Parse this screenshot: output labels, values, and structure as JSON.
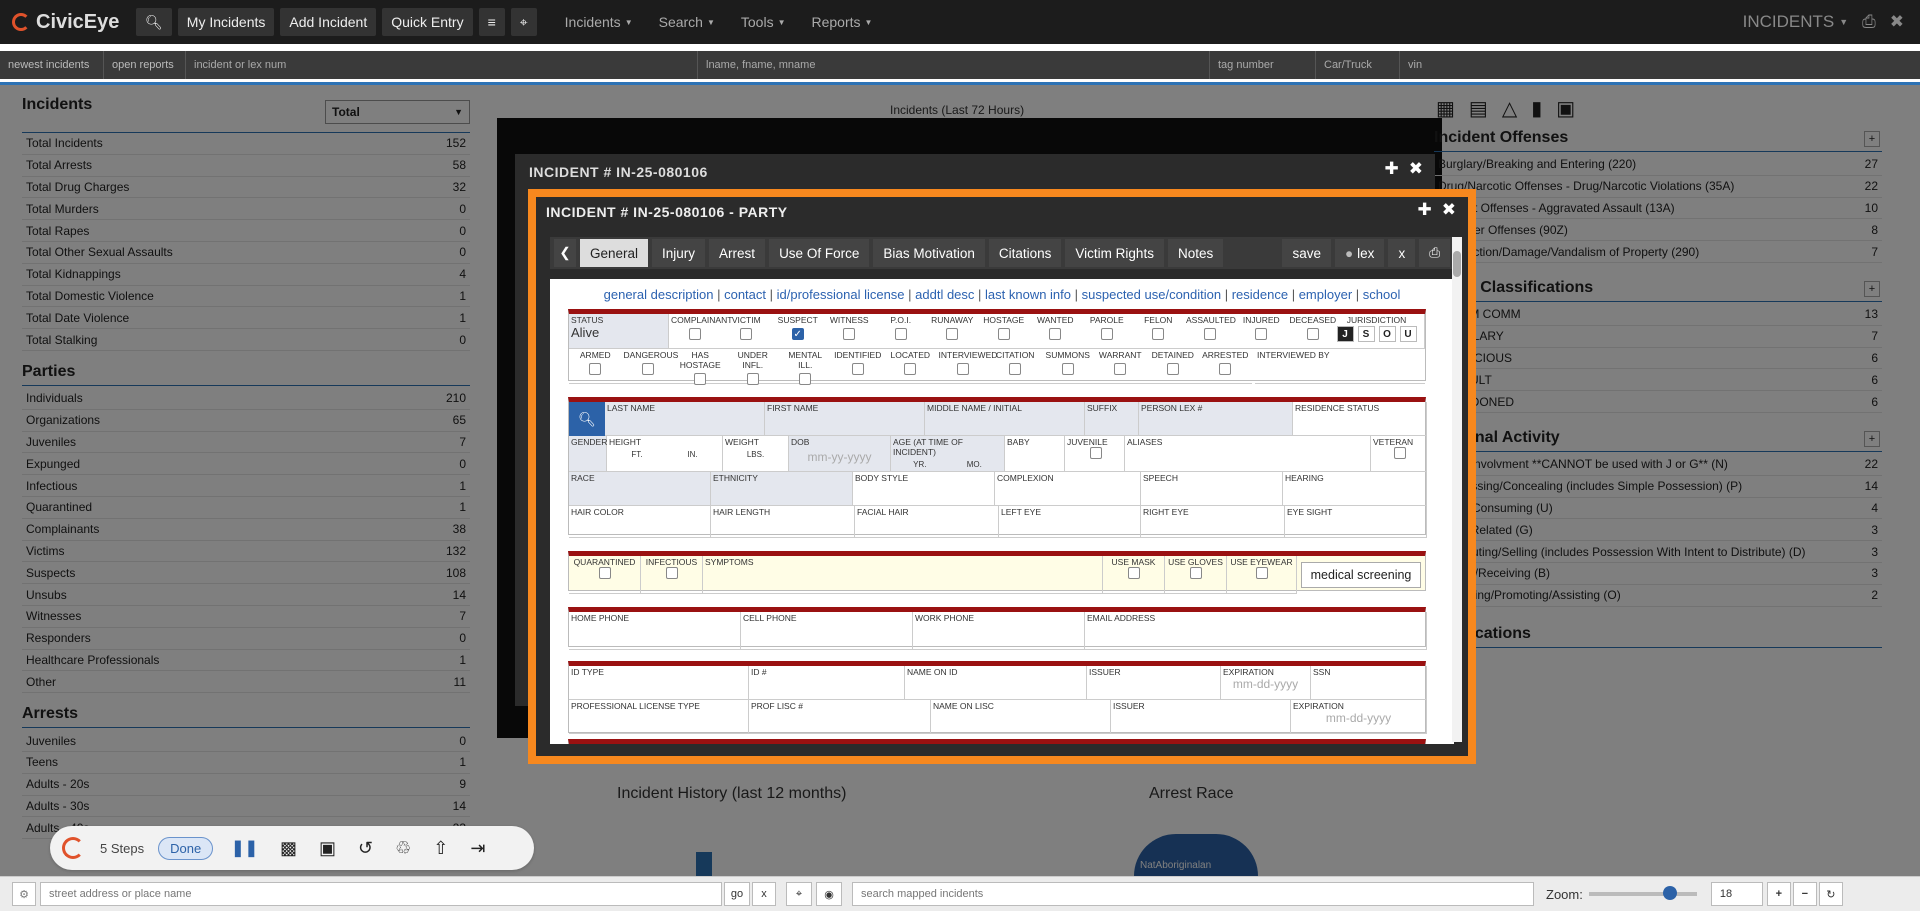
{
  "topbar": {
    "brand": "CivicEye",
    "buttons": [
      "My Incidents",
      "Add Incident",
      "Quick Entry"
    ],
    "menus": [
      "Incidents",
      "Search",
      "Tools",
      "Reports"
    ],
    "section_title": "INCIDENTS"
  },
  "searchbar": {
    "chips": [
      "newest incidents",
      "open reports"
    ],
    "incident_placeholder": "incident or lex num",
    "name_placeholder": "lname, fname, mname",
    "tag_placeholder": "tag number",
    "car_placeholder": "Car/Truck",
    "vin_placeholder": "vin"
  },
  "left": {
    "incidents_title": "Incidents",
    "filter_value": "Total",
    "incidents": [
      {
        "label": "Total Incidents",
        "value": "152"
      },
      {
        "label": "Total Arrests",
        "value": "58"
      },
      {
        "label": "Total Drug Charges",
        "value": "32"
      },
      {
        "label": "Total Murders",
        "value": "0"
      },
      {
        "label": "Total Rapes",
        "value": "0"
      },
      {
        "label": "Total Other Sexual Assaults",
        "value": "0"
      },
      {
        "label": "Total Kidnappings",
        "value": "4"
      },
      {
        "label": "Total Domestic Violence",
        "value": "1"
      },
      {
        "label": "Total Date Violence",
        "value": "1"
      },
      {
        "label": "Total Stalking",
        "value": "0"
      }
    ],
    "parties_title": "Parties",
    "parties": [
      {
        "label": "Individuals",
        "value": "210"
      },
      {
        "label": "Organizations",
        "value": "65"
      },
      {
        "label": "Juveniles",
        "value": "7"
      },
      {
        "label": "Expunged",
        "value": "0"
      },
      {
        "label": "Infectious",
        "value": "1"
      },
      {
        "label": "Quarantined",
        "value": "1"
      },
      {
        "label": "Complainants",
        "value": "38"
      },
      {
        "label": "Victims",
        "value": "132"
      },
      {
        "label": "Suspects",
        "value": "108"
      },
      {
        "label": "Unsubs",
        "value": "14"
      },
      {
        "label": "Witnesses",
        "value": "7"
      },
      {
        "label": "Responders",
        "value": "0"
      },
      {
        "label": "Healthcare Professionals",
        "value": "1"
      },
      {
        "label": "Other",
        "value": "11"
      }
    ],
    "arrests_title": "Arrests",
    "arrests": [
      {
        "label": "Juveniles",
        "value": "0"
      },
      {
        "label": "Teens",
        "value": "1"
      },
      {
        "label": "Adults - 20s",
        "value": "9"
      },
      {
        "label": "Adults - 30s",
        "value": "14"
      },
      {
        "label": "Adults - 40s",
        "value": "23"
      }
    ]
  },
  "middle": {
    "chart_title": "Incidents (Last 72 Hours)",
    "history_title": "Incident History (last 12 months)",
    "race_title": "Arrest Race",
    "race_label": "NatAboriginalan"
  },
  "right": {
    "offenses_title": "Incident Offenses",
    "offenses": [
      {
        "label": "Burglary/Breaking and Entering (220)",
        "value": "27"
      },
      {
        "label": "Drug/Narcotic Offenses - Drug/Narcotic Violations (35A)",
        "value": "22"
      },
      {
        "label": "Assault Offenses - Aggravated Assault (13A)",
        "value": "10"
      },
      {
        "label": "All Other Offenses (90Z)",
        "value": "8"
      },
      {
        "label": "Destruction/Damage/Vandalism of Property (290)",
        "value": "7"
      }
    ],
    "classifications_title": "Initial Classifications",
    "classifications": [
      {
        "label": "ALARM COMM",
        "value": "13"
      },
      {
        "label": "BURGLARY",
        "value": "7"
      },
      {
        "label": "SUSPICIOUS",
        "value": "6"
      },
      {
        "label": "ASSAULT",
        "value": "6"
      },
      {
        "label": "ABANDONED",
        "value": "6"
      }
    ],
    "activity_title": "Criminal Activity",
    "activity": [
      {
        "label": "Gang Involvment **CANNOT be used with J or G** (N)",
        "value": "22"
      },
      {
        "label": "Possessing/Concealing (includes Simple Possession) (P)",
        "value": "14"
      },
      {
        "label": "Using/Consuming (U)",
        "value": "4"
      },
      {
        "label": "Gang Related (G)",
        "value": "3"
      },
      {
        "label": "Distributing/Selling (includes Possession With Intent to Distribute) (D)",
        "value": "3"
      },
      {
        "label": "Buying/Receiving (B)",
        "value": "3"
      },
      {
        "label": "Operating/Promoting/Assisting (O)",
        "value": "2"
      }
    ],
    "notifications_title": "Notifications",
    "notifications_text": "None"
  },
  "bg_window": {
    "title": "INCIDENT # IN-25-080106"
  },
  "modal": {
    "title": "INCIDENT # IN-25-080106 - PARTY",
    "tabs": [
      "General",
      "Injury",
      "Arrest",
      "Use Of Force",
      "Bias Motivation",
      "Citations",
      "Victim Rights",
      "Notes"
    ],
    "save_label": "save",
    "user_label": "lex",
    "close_label": "x",
    "section_links": [
      "general description",
      "contact",
      "id/professional license",
      "addtl desc",
      "last known info",
      "suspected use/condition",
      "residence",
      "employer",
      "school"
    ],
    "status_label": "STATUS",
    "status_value": "Alive",
    "flags_row1": [
      "COMPLAINANT",
      "VICTIM",
      "SUSPECT",
      "WITNESS",
      "P.O.I.",
      "RUNAWAY",
      "HOSTAGE",
      "WANTED",
      "PAROLE",
      "FELON",
      "ASSAULTED",
      "INJURED",
      "DECEASED"
    ],
    "jurisdiction_label": "JURISDICTION",
    "jurisdiction_options": [
      "J",
      "S",
      "O",
      "U"
    ],
    "flags_row2": [
      "ARMED",
      "DANGEROUS",
      "HAS HOSTAGE",
      "UNDER INFL.",
      "MENTAL ILL.",
      "IDENTIFIED",
      "LOCATED",
      "INTERVIEWED",
      "CITATION",
      "SUMMONS",
      "WARRANT",
      "DETAINED",
      "ARRESTED"
    ],
    "interviewed_by": "INTERVIEWED BY",
    "name_fields": [
      "LAST NAME",
      "FIRST NAME",
      "MIDDLE NAME / INITIAL",
      "SUFFIX",
      "PERSON LEX #",
      "RESIDENCE STATUS"
    ],
    "bio_fields": {
      "gender": "GENDER",
      "height": "HEIGHT",
      "ft": "FT.",
      "in": "IN.",
      "weight": "WEIGHT",
      "lbs": "LBS.",
      "dob": "DOB",
      "dob_placeholder": "mm-yy-yyyy",
      "age": "AGE (AT TIME OF INCIDENT)",
      "yr": "YR.",
      "mo": "MO.",
      "baby": "BABY",
      "juvenile": "JUVENILE",
      "aliases": "ALIASES",
      "veteran": "VETERAN"
    },
    "desc_row1": [
      "RACE",
      "ETHNICITY",
      "BODY STYLE",
      "COMPLEXION",
      "SPEECH",
      "HEARING"
    ],
    "desc_row2": [
      "HAIR COLOR",
      "HAIR LENGTH",
      "FACIAL HAIR",
      "LEFT EYE",
      "RIGHT EYE",
      "EYE SIGHT"
    ],
    "medical": {
      "quarantined": "QUARANTINED",
      "infectious": "INFECTIOUS",
      "symptoms": "SYMPTOMS",
      "mask": "USE MASK",
      "gloves": "USE GLOVES",
      "eyewear": "USE EYEWEAR",
      "screening_button": "medical screening"
    },
    "contact_fields": [
      "HOME PHONE",
      "CELL PHONE",
      "WORK PHONE",
      "EMAIL ADDRESS"
    ],
    "id_fields": [
      "ID TYPE",
      "ID #",
      "NAME ON ID",
      "ISSUER",
      "EXPIRATION",
      "SSN"
    ],
    "id_exp_placeholder": "mm-dd-yyyy",
    "lic_fields": [
      "PROFESSIONAL LICENSE TYPE",
      "PROF LISC #",
      "NAME ON LISC",
      "ISSUER",
      "EXPIRATION"
    ],
    "lic_exp_placeholder": "mm-dd-yyyy"
  },
  "steps_widget": {
    "steps_label": "5 Steps",
    "done_label": "Done"
  },
  "bottombar": {
    "address_placeholder": "street address or place name",
    "go_label": "go",
    "clear_label": "x",
    "mapsearch_placeholder": "search mapped incidents",
    "zoom_label": "Zoom:",
    "zoom_value": "18",
    "zoom_fraction": 0.75
  },
  "colors": {
    "accent": "#2c72b5",
    "modal_border": "#f7881e",
    "form_rule": "#9a1111",
    "topbar": "#1c1c1c"
  }
}
